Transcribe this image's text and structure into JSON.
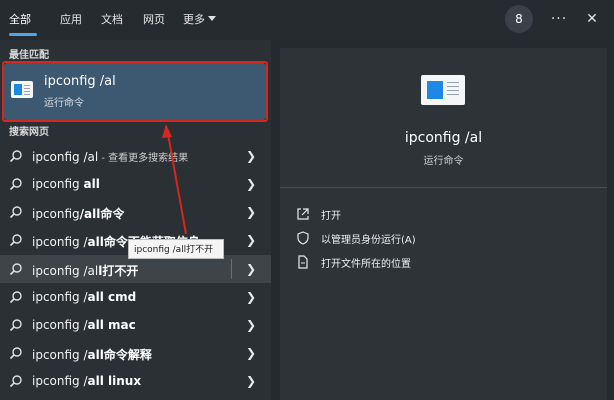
{
  "tabs": [
    {
      "label": "全部"
    },
    {
      "label": "应用"
    },
    {
      "label": "文档"
    },
    {
      "label": "网页"
    },
    {
      "label": "更多"
    }
  ],
  "header": {
    "badge": "8",
    "more_options": "···",
    "close": "✕"
  },
  "best_match": {
    "section_label": "最佳匹配",
    "title": "ipconfig /al",
    "subtitle": "运行命令"
  },
  "web_search": {
    "section_label": "搜索网页",
    "items": [
      {
        "query": "ipconfig /al",
        "suffix": " - 查看更多搜索结果"
      },
      {
        "query": "ipconfig ",
        "bold": "all"
      },
      {
        "query": "ipconfig",
        "bold": "/all命令"
      },
      {
        "query": "ipconfig /",
        "bold": "all命令不能获取信息"
      },
      {
        "query": "ipconfig /al",
        "bold": "l打不开"
      },
      {
        "query": "ipconfig /",
        "bold": "all cmd"
      },
      {
        "query": "ipconfig /",
        "bold": "all mac"
      },
      {
        "query": "ipconfig /",
        "bold": "all命令解释"
      },
      {
        "query": "ipconfig /",
        "bold": "all linux"
      }
    ]
  },
  "tooltip": "ipconfig /all打不开",
  "detail": {
    "title": "ipconfig /al",
    "subtitle": "运行命令",
    "actions": [
      {
        "label": "打开",
        "icon": "open-icon"
      },
      {
        "label": "以管理员身份运行(A)",
        "icon": "shield-icon"
      },
      {
        "label": "打开文件所在的位置",
        "icon": "file-location-icon"
      }
    ]
  },
  "colors": {
    "accent": "#4ea6e8",
    "highlight_outline": "#d9261c",
    "selected_bg": "#3d5871"
  }
}
